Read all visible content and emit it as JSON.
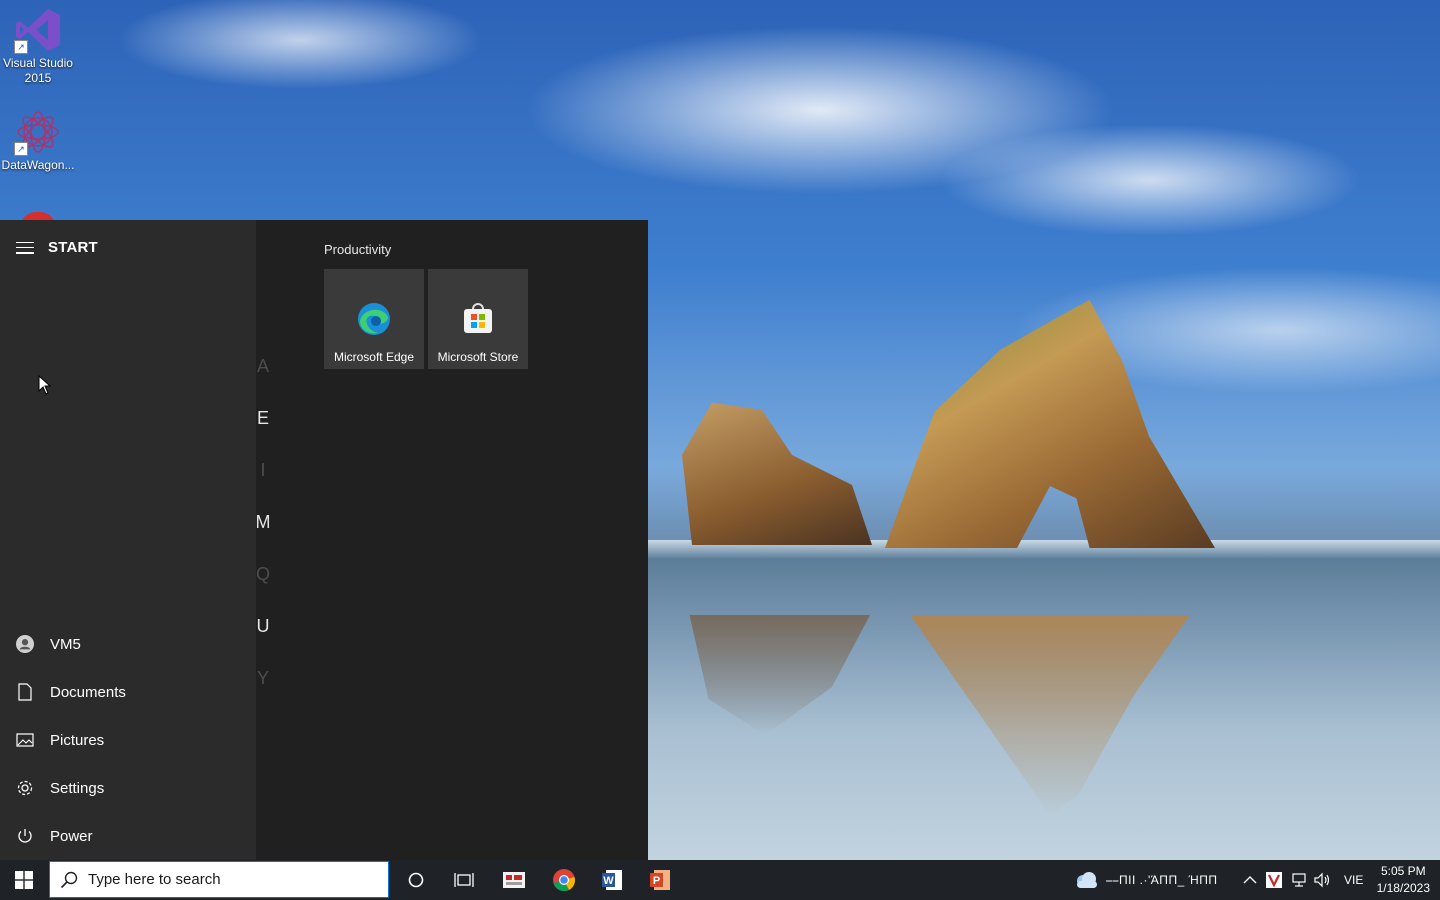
{
  "desktop": {
    "icons": [
      {
        "label": "Visual Studio 2015",
        "icon": "visual-studio-icon"
      },
      {
        "label": "DataWagon...",
        "icon": "datawagon-icon"
      }
    ]
  },
  "start_menu": {
    "title": "START",
    "letters": [
      "A",
      "E",
      "I",
      "M",
      "Q",
      "U",
      "Y"
    ],
    "group_title": "Productivity",
    "tiles": [
      {
        "label": "Microsoft Edge",
        "icon": "edge-icon"
      },
      {
        "label": "Microsoft Store",
        "icon": "store-icon"
      }
    ],
    "nav": [
      {
        "label": "VM5",
        "icon": "user-icon"
      },
      {
        "label": "Documents",
        "icon": "document-icon"
      },
      {
        "label": "Pictures",
        "icon": "pictures-icon"
      },
      {
        "label": "Settings",
        "icon": "gear-icon"
      },
      {
        "label": "Power",
        "icon": "power-icon"
      }
    ]
  },
  "taskbar": {
    "search_placeholder": "Type here to search",
    "apps": [
      "cortana-icon",
      "task-view-icon",
      "app-icon",
      "chrome-icon",
      "word-icon",
      "powerpoint-icon"
    ],
    "tray": {
      "weather_text": "⎯⎯ΠΙΙ .·'ΆΠΠ_ ΉΠΠ",
      "language": "VIE",
      "time": "5:05 PM",
      "date": "1/18/2023"
    }
  }
}
